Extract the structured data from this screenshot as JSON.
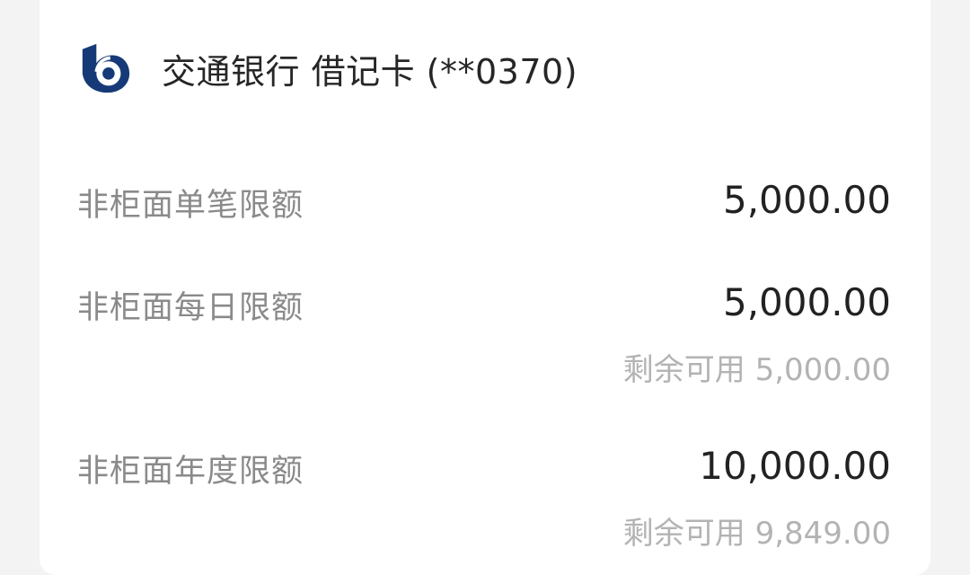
{
  "bank": {
    "icon": "bocom-logo-icon",
    "title": "交通银行 借记卡 (**0370)"
  },
  "limits": [
    {
      "label": "非柜面单笔限额",
      "amount": "5,000.00"
    },
    {
      "label": "非柜面每日限额",
      "amount": "5,000.00",
      "remain": "剩余可用 5,000.00"
    },
    {
      "label": "非柜面年度限额",
      "amount": "10,000.00",
      "remain": "剩余可用 9,849.00"
    }
  ],
  "colors": {
    "logo": "#163a78",
    "label": "#8a8a8a",
    "amount": "#222222",
    "remain": "#b3b3b3"
  }
}
